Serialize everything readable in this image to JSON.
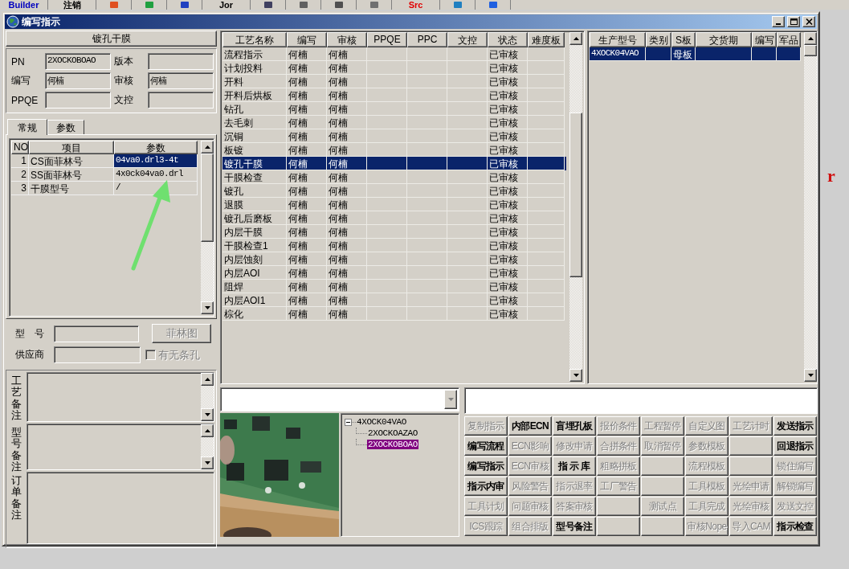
{
  "taskbar": {
    "items": [
      {
        "kind": "text",
        "label": "Builder",
        "color": "#0000c0"
      },
      {
        "kind": "text",
        "label": "注销",
        "color": "#000000"
      },
      {
        "kind": "icon",
        "color": "#e05020"
      },
      {
        "kind": "icon",
        "color": "#20a040"
      },
      {
        "kind": "icon",
        "color": "#2040c0"
      },
      {
        "kind": "text",
        "label": "Jor",
        "color": "#000000"
      },
      {
        "kind": "icon",
        "color": "#404060"
      },
      {
        "kind": "icon",
        "color": "#606060"
      },
      {
        "kind": "icon",
        "color": "#505050"
      },
      {
        "kind": "icon",
        "color": "#707070"
      },
      {
        "kind": "text",
        "label": "Src",
        "color": "#e00000"
      },
      {
        "kind": "icon",
        "color": "#2080c0"
      },
      {
        "kind": "icon",
        "color": "#2060e0"
      }
    ]
  },
  "desktop": {
    "text": "r"
  },
  "window": {
    "title": "编写指示"
  },
  "left_panel": {
    "header": "镀孔干膜",
    "fields": [
      {
        "label": "PN",
        "value": "2XOCKOBOAO"
      },
      {
        "label": "版本"
      },
      {
        "label": "编写",
        "value": "何楠"
      },
      {
        "label": "审核",
        "value": "何楠"
      },
      {
        "label": "PPQE"
      },
      {
        "label": "文控"
      }
    ],
    "tabs": [
      {
        "label": "常规",
        "selected": true
      },
      {
        "label": "参数",
        "selected": false
      }
    ],
    "param_table": {
      "columns": [
        "NO",
        "项目",
        "参数"
      ],
      "rows": [
        {
          "no": "1",
          "item": "CS面菲林号",
          "param": "04va0.drl3-4t",
          "selected": true
        },
        {
          "no": "2",
          "item": "SS面菲林号",
          "param": "4x0ck04va0.drl",
          "selected": false
        },
        {
          "no": "3",
          "item": "干膜型号",
          "param": "/",
          "selected": false
        }
      ]
    },
    "model_label": "型　号",
    "film_button": {
      "label": "菲林图",
      "disabled": true
    },
    "supplier_label": "供应商",
    "hole_checkbox": {
      "label": "有无条孔",
      "checked": false,
      "disabled": true
    },
    "memos": [
      {
        "label": "工艺备注",
        "kind": "scrolled"
      },
      {
        "label": "型号备注",
        "kind": "scrolled"
      },
      {
        "label": "订单备注",
        "kind": "plain"
      }
    ]
  },
  "process_table": {
    "columns": [
      "工艺名称",
      "编写",
      "审核",
      "PPQE",
      "PPC",
      "文控",
      "状态",
      "难度板"
    ],
    "rows": [
      {
        "name": "流程指示",
        "writer": "何楠",
        "reviewer": "何楠",
        "status": "已审核",
        "selected": false
      },
      {
        "name": "计划投料",
        "writer": "何楠",
        "reviewer": "何楠",
        "status": "已审核",
        "selected": false
      },
      {
        "name": "开料",
        "writer": "何楠",
        "reviewer": "何楠",
        "status": "已审核",
        "selected": false
      },
      {
        "name": "开料后烘板",
        "writer": "何楠",
        "reviewer": "何楠",
        "status": "已审核",
        "selected": false
      },
      {
        "name": "钻孔",
        "writer": "何楠",
        "reviewer": "何楠",
        "status": "已审核",
        "selected": false
      },
      {
        "name": "去毛刺",
        "writer": "何楠",
        "reviewer": "何楠",
        "status": "已审核",
        "selected": false
      },
      {
        "name": "沉铜",
        "writer": "何楠",
        "reviewer": "何楠",
        "status": "已审核",
        "selected": false
      },
      {
        "name": "板镀",
        "writer": "何楠",
        "reviewer": "何楠",
        "status": "已审核",
        "selected": false
      },
      {
        "name": "镀孔干膜",
        "writer": "何楠",
        "reviewer": "何楠",
        "status": "已审核",
        "selected": true
      },
      {
        "name": "干膜检查",
        "writer": "何楠",
        "reviewer": "何楠",
        "status": "已审核",
        "selected": false
      },
      {
        "name": "镀孔",
        "writer": "何楠",
        "reviewer": "何楠",
        "status": "已审核",
        "selected": false
      },
      {
        "name": "退膜",
        "writer": "何楠",
        "reviewer": "何楠",
        "status": "已审核",
        "selected": false
      },
      {
        "name": "镀孔后磨板",
        "writer": "何楠",
        "reviewer": "何楠",
        "status": "已审核",
        "selected": false
      },
      {
        "name": "内层干膜",
        "writer": "何楠",
        "reviewer": "何楠",
        "status": "已审核",
        "selected": false
      },
      {
        "name": "干膜检查1",
        "writer": "何楠",
        "reviewer": "何楠",
        "status": "已审核",
        "selected": false
      },
      {
        "name": "内层蚀刻",
        "writer": "何楠",
        "reviewer": "何楠",
        "status": "已审核",
        "selected": false
      },
      {
        "name": "内层AOI",
        "writer": "何楠",
        "reviewer": "何楠",
        "status": "已审核",
        "selected": false
      },
      {
        "name": "阻焊",
        "writer": "何楠",
        "reviewer": "何楠",
        "status": "已审核",
        "selected": false
      },
      {
        "name": "内层AOI1",
        "writer": "何楠",
        "reviewer": "何楠",
        "status": "已审核",
        "selected": false
      },
      {
        "name": "棕化",
        "writer": "何楠",
        "reviewer": "何楠",
        "status": "已审核",
        "selected": false
      }
    ]
  },
  "model_table": {
    "columns": [
      "生产型号",
      "类别",
      "S板",
      "交货期",
      "编写",
      "军品"
    ],
    "rows": [
      {
        "model": "4XOCK04VAO",
        "board": "母板",
        "selected": true
      }
    ]
  },
  "tree": {
    "label": "4XOCK04VAO",
    "selected": false,
    "expanded": true,
    "children": [
      {
        "label": "2XOCKOAZAO",
        "selected": false
      },
      {
        "label": "2XOCKOBOAO",
        "selected": true
      }
    ]
  },
  "action_buttons": [
    {
      "kind": "button",
      "label": "复制指示",
      "disabled": true
    },
    {
      "kind": "button",
      "label": "内部ECN",
      "disabled": false
    },
    {
      "kind": "button",
      "label": "盲埋孔板",
      "disabled": false
    },
    {
      "kind": "button",
      "label": "报价条件",
      "disabled": true
    },
    {
      "kind": "button",
      "label": "工程暂停",
      "disabled": true
    },
    {
      "kind": "button",
      "label": "自定义图",
      "disabled": true
    },
    {
      "kind": "button",
      "label": "工艺计时",
      "disabled": true
    },
    {
      "kind": "button",
      "label": "发送指示",
      "disabled": false
    },
    {
      "kind": "button",
      "label": "编写流程",
      "disabled": false
    },
    {
      "kind": "button",
      "label": "ECN影响",
      "disabled": true
    },
    {
      "kind": "button",
      "label": "修改申请",
      "disabled": true
    },
    {
      "kind": "button",
      "label": "合拼条件",
      "disabled": true
    },
    {
      "kind": "button",
      "label": "取消暂停",
      "disabled": true
    },
    {
      "kind": "button",
      "label": "参数模板",
      "disabled": true
    },
    {
      "kind": "blank"
    },
    {
      "kind": "button",
      "label": "回退指示",
      "disabled": false
    },
    {
      "kind": "button",
      "label": "编写指示",
      "disabled": false
    },
    {
      "kind": "button",
      "label": "ECN审核",
      "disabled": true
    },
    {
      "kind": "button",
      "label": "指 示 库",
      "disabled": false
    },
    {
      "kind": "button",
      "label": "粗略拼板",
      "disabled": true
    },
    {
      "kind": "blank"
    },
    {
      "kind": "button",
      "label": "流程模板",
      "disabled": true
    },
    {
      "kind": "blank"
    },
    {
      "kind": "button",
      "label": "锁住编写",
      "disabled": true
    },
    {
      "kind": "button",
      "label": "指示内审",
      "disabled": false
    },
    {
      "kind": "button",
      "label": "风险警告",
      "disabled": true
    },
    {
      "kind": "button",
      "label": "指示退率",
      "disabled": true
    },
    {
      "kind": "button",
      "label": "工厂警告",
      "disabled": true
    },
    {
      "kind": "blank"
    },
    {
      "kind": "button",
      "label": "工具模板",
      "disabled": true
    },
    {
      "kind": "button",
      "label": "光绘申请",
      "disabled": true
    },
    {
      "kind": "button",
      "label": "解锁编写",
      "disabled": true
    },
    {
      "kind": "button",
      "label": "工具计划",
      "disabled": true
    },
    {
      "kind": "button",
      "label": "问题审核",
      "disabled": true
    },
    {
      "kind": "button",
      "label": "答案审核",
      "disabled": true
    },
    {
      "kind": "blank"
    },
    {
      "kind": "button",
      "label": "测试点",
      "disabled": true
    },
    {
      "kind": "button",
      "label": "工具完成",
      "disabled": true
    },
    {
      "kind": "button",
      "label": "光绘审核",
      "disabled": true
    },
    {
      "kind": "button",
      "label": "发送文控",
      "disabled": true
    },
    {
      "kind": "button",
      "label": "ICS跟踪",
      "disabled": true
    },
    {
      "kind": "button",
      "label": "组合排版",
      "disabled": true
    },
    {
      "kind": "button",
      "label": "型号备注",
      "disabled": false
    },
    {
      "kind": "blank"
    },
    {
      "kind": "blank"
    },
    {
      "kind": "button",
      "label": "审核Nope",
      "disabled": true
    },
    {
      "kind": "button",
      "label": "导入CAM",
      "disabled": true
    },
    {
      "kind": "button",
      "label": "指示检查",
      "disabled": false
    }
  ]
}
